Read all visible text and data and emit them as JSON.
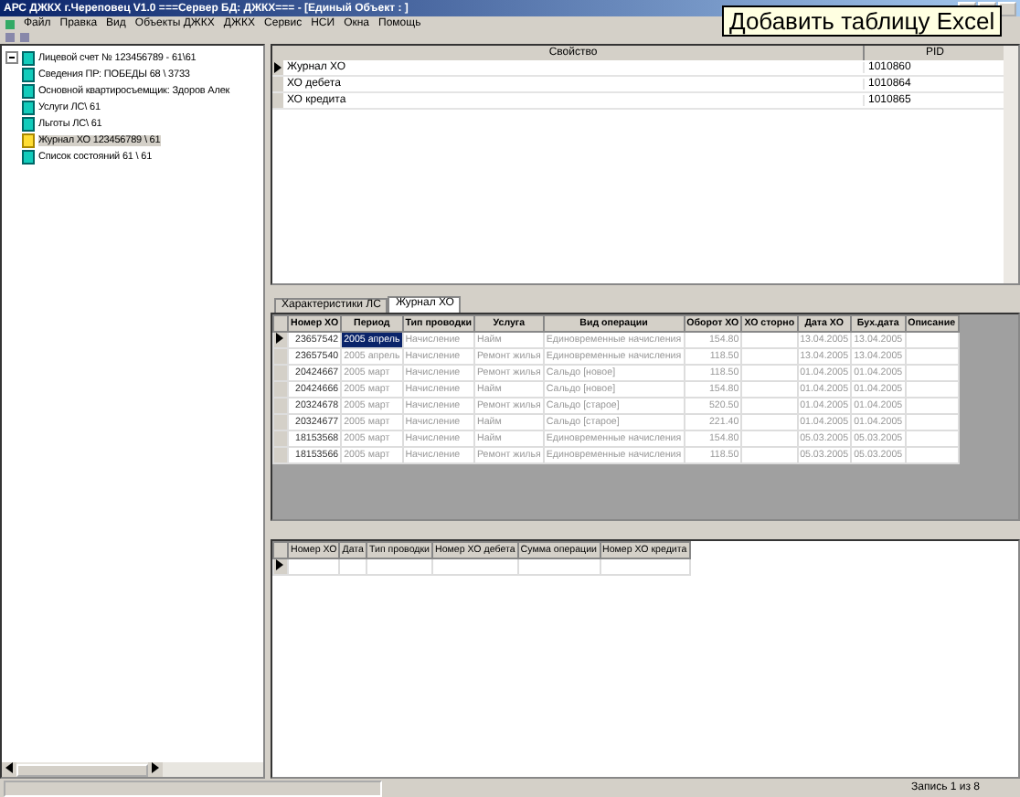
{
  "window": {
    "title": "АРС ДЖКХ г.Череповец V1.0 ===Сервер БД: ДЖКХ=== - [Единый Объект : ]"
  },
  "menu": [
    "Файл",
    "Правка",
    "Вид",
    "Объекты ДЖКХ",
    "ДЖКХ",
    "Сервис",
    "НСИ",
    "Окна",
    "Помощь"
  ],
  "tooltip": "Добавить таблицу Excel",
  "tree": {
    "label": "Лицевой счет № 123456789 - 61\\61",
    "expanded": true,
    "children": [
      {
        "label": "Сведения ПР: ПОБЕДЫ 68 \\ 3733",
        "selected": false
      },
      {
        "label": "Основной квартиросъемщик: Здоров Алек",
        "selected": false
      },
      {
        "label": "Услуги ЛС\\ 61",
        "selected": false
      },
      {
        "label": "Льготы ЛС\\ 61",
        "selected": false
      },
      {
        "label": "Журнал ХО 123456789 \\ 61",
        "selected": true
      },
      {
        "label": "Список состояний 61 \\ 61",
        "selected": false
      }
    ]
  },
  "properties": {
    "columns": [
      "Свойство",
      "PID"
    ],
    "rows": [
      {
        "cells": [
          "Журнал ХО",
          "1010860"
        ],
        "selected": true
      },
      {
        "cells": [
          "ХО дебета",
          "1010864"
        ],
        "selected": false
      },
      {
        "cells": [
          "ХО кредита",
          "1010865"
        ],
        "selected": false
      }
    ]
  },
  "tabs": [
    {
      "label": "Характеристики ЛС",
      "selected": false
    },
    {
      "label": "Журнал ХО",
      "selected": true
    }
  ],
  "journal": {
    "columns": [
      "Номер ХО",
      "Период",
      "Тип проводки",
      "Услуга",
      "Вид операции",
      "Оборот ХО",
      "ХО сторно",
      "Дата ХО",
      "Бух.дата",
      "Описание"
    ],
    "rows": [
      {
        "cells": [
          "23657542",
          "2005 апрель",
          "Начисление",
          "Найм",
          "Единовременные начисления",
          "154.80",
          "",
          "13.04.2005",
          "13.04.2005",
          ""
        ],
        "selected": true
      },
      {
        "cells": [
          "23657540",
          "2005 апрель",
          "Начисление",
          "Ремонт жилья",
          "Единовременные начисления",
          "118.50",
          "",
          "13.04.2005",
          "13.04.2005",
          ""
        ],
        "selected": false
      },
      {
        "cells": [
          "20424667",
          "2005 март",
          "Начисление",
          "Ремонт жилья",
          "Сальдо [новое]",
          "118.50",
          "",
          "01.04.2005",
          "01.04.2005",
          ""
        ],
        "selected": false
      },
      {
        "cells": [
          "20424666",
          "2005 март",
          "Начисление",
          "Найм",
          "Сальдо [новое]",
          "154.80",
          "",
          "01.04.2005",
          "01.04.2005",
          ""
        ],
        "selected": false
      },
      {
        "cells": [
          "20324678",
          "2005 март",
          "Начисление",
          "Ремонт жилья",
          "Сальдо [старое]",
          "520.50",
          "",
          "01.04.2005",
          "01.04.2005",
          ""
        ],
        "selected": false
      },
      {
        "cells": [
          "20324677",
          "2005 март",
          "Начисление",
          "Найм",
          "Сальдо [старое]",
          "221.40",
          "",
          "01.04.2005",
          "01.04.2005",
          ""
        ],
        "selected": false
      },
      {
        "cells": [
          "18153568",
          "2005 март",
          "Начисление",
          "Найм",
          "Единовременные начисления",
          "154.80",
          "",
          "05.03.2005",
          "05.03.2005",
          ""
        ],
        "selected": false
      },
      {
        "cells": [
          "18153566",
          "2005 март",
          "Начисление",
          "Ремонт жилья",
          "Единовременные начисления",
          "118.50",
          "",
          "05.03.2005",
          "05.03.2005",
          ""
        ],
        "selected": false
      }
    ]
  },
  "details": {
    "columns": [
      "Номер ХО",
      "Дата",
      "Тип проводки",
      "Номер ХО дебета",
      "Сумма операции",
      "Номер ХО кредита"
    ]
  },
  "status_bar": "Запись 1 из 8"
}
